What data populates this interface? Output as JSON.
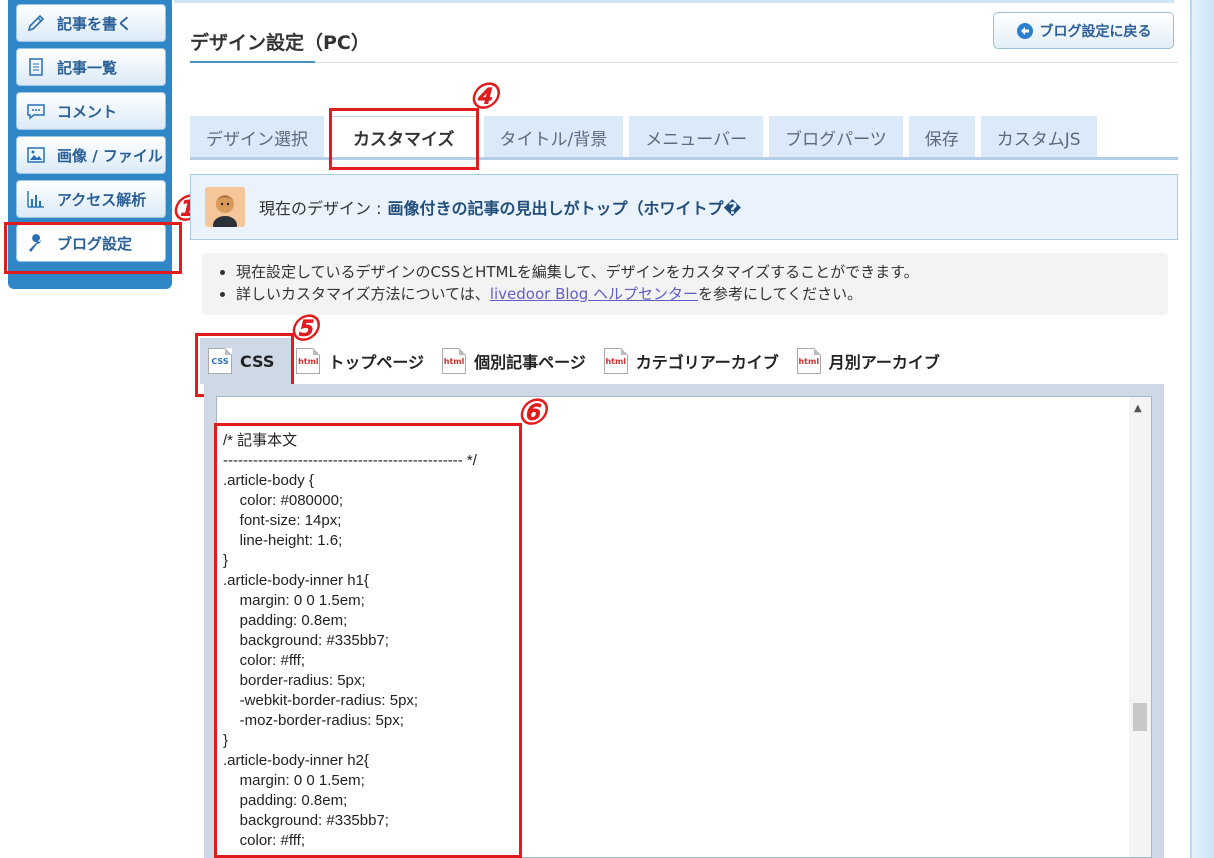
{
  "sidebar": {
    "items": [
      {
        "label": "記事を書く",
        "icon": "pencil-icon"
      },
      {
        "label": "記事一覧",
        "icon": "document-list-icon"
      },
      {
        "label": "コメント",
        "icon": "speech-bubble-icon"
      },
      {
        "label": "画像 / ファイル",
        "icon": "image-icon"
      },
      {
        "label": "アクセス解析",
        "icon": "bar-chart-icon"
      },
      {
        "label": "ブログ設定",
        "icon": "wrench-icon"
      }
    ]
  },
  "header": {
    "title": "デザイン設定（PC）",
    "back_button": "ブログ設定に戻る"
  },
  "tabs": [
    {
      "label": "デザイン選択"
    },
    {
      "label": "カスタマイズ"
    },
    {
      "label": "タイトル/背景"
    },
    {
      "label": "メニューバー"
    },
    {
      "label": "ブログパーツ"
    },
    {
      "label": "保存"
    },
    {
      "label": "カスタムJS"
    }
  ],
  "current_design": {
    "prefix": "現在のデザイン :",
    "name": "画像付きの記事の見出しがトップ（ホワイトプ�"
  },
  "info": {
    "line1": "現在設定しているデザインのCSSとHTMLを編集して、デザインをカスタマイズすることができます。",
    "line2_before": "詳しいカスタマイズ方法については、",
    "line2_link": "livedoor Blog ヘルプセンター",
    "line2_after": "を参考にしてください。"
  },
  "file_tabs": [
    {
      "label": "CSS",
      "icon_text": "CSS"
    },
    {
      "label": "トップページ",
      "icon_text": "html"
    },
    {
      "label": "個別記事ページ",
      "icon_text": "html"
    },
    {
      "label": "カテゴリアーカイブ",
      "icon_text": "html"
    },
    {
      "label": "月別アーカイブ",
      "icon_text": "html"
    }
  ],
  "annotations": {
    "m1": "①",
    "m4": "④",
    "m5": "⑤",
    "m6": "⑥"
  },
  "editor": {
    "code": "/* 記事本文\n------------------------------------------------ */\n.article-body {\n    color: #080000;\n    font-size: 14px;\n    line-height: 1.6;\n}\n.article-body-inner h1{\n    margin: 0 0 1.5em;\n    padding: 0.8em;\n    background: #335bb7;\n    color: #fff;\n    border-radius: 5px;\n    -webkit-border-radius: 5px;\n    -moz-border-radius: 5px;\n}\n.article-body-inner h2{\n    margin: 0 0 1.5em;\n    padding: 0.8em;\n    background: #335bb7;\n    color: #fff;",
    "scroll_up_arrow": "▲"
  },
  "colors": {
    "sidebar_bg": "#2f87c8",
    "annotation_red": "#e01c1c",
    "tab_bg": "#dbe9f8",
    "link": "#5f5fc4"
  }
}
